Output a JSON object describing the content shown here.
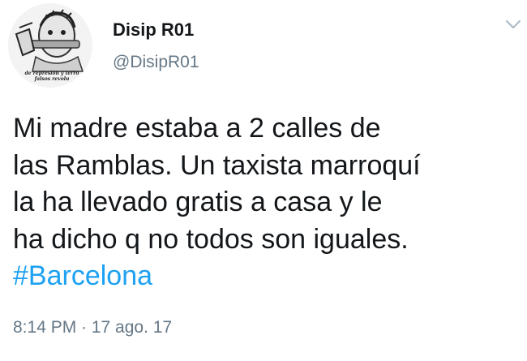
{
  "user": {
    "display_name": "Disip R01",
    "handle": "@DisipR01",
    "avatar_caption_line1": "de represión y terro",
    "avatar_caption_line2": "falsos revolu"
  },
  "icons": {
    "menu": "chevron-down-icon"
  },
  "tweet": {
    "text": "Mi madre estaba a 2 calles de\nlas Ramblas. Un taxista marroquí\nla ha llevado gratis a casa y le\nha dicho q no todos son iguales.",
    "hashtag": "#Barcelona",
    "timestamp": "8:14 PM · 17 ago. 17"
  },
  "colors": {
    "link": "#1da1f2",
    "secondary_text": "#657786",
    "primary_text": "#14171a"
  }
}
